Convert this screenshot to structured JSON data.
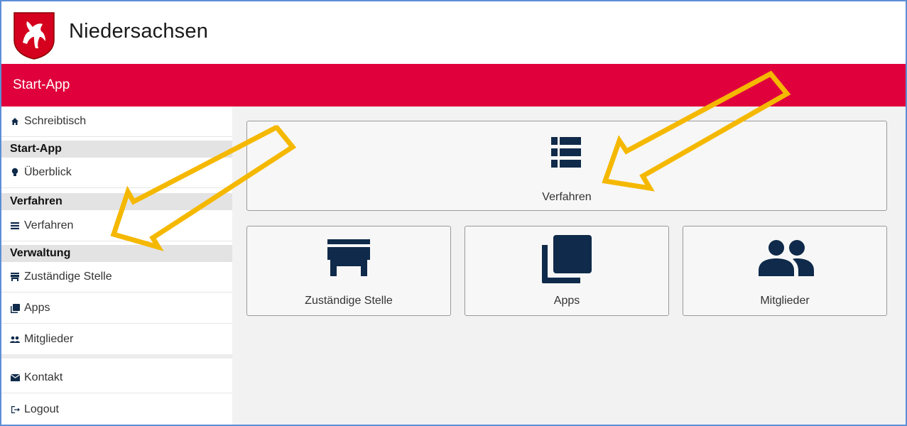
{
  "header": {
    "brand": "Niedersachsen"
  },
  "appbar": {
    "title": "Start-App"
  },
  "sidebar": {
    "items": [
      {
        "label": "Schreibtisch",
        "icon": "home-icon"
      },
      {
        "section": "Start-App"
      },
      {
        "label": "Überblick",
        "icon": "lightbulb-icon"
      },
      {
        "section": "Verfahren"
      },
      {
        "label": "Verfahren",
        "icon": "list-icon"
      },
      {
        "section": "Verwaltung"
      },
      {
        "label": "Zuständige Stelle",
        "icon": "store-icon"
      },
      {
        "label": "Apps",
        "icon": "apps-icon"
      },
      {
        "label": "Mitglieder",
        "icon": "people-icon"
      },
      {
        "label": "Kontakt",
        "icon": "envelope-icon"
      },
      {
        "label": "Logout",
        "icon": "logout-icon"
      }
    ]
  },
  "tiles": {
    "verfahren": "Verfahren",
    "stelle": "Zuständige Stelle",
    "apps": "Apps",
    "mitglieder": "Mitglieder"
  },
  "colors": {
    "accent": "#e0003c",
    "icon": "#0f2a4a",
    "arrow": "#f5b800"
  }
}
